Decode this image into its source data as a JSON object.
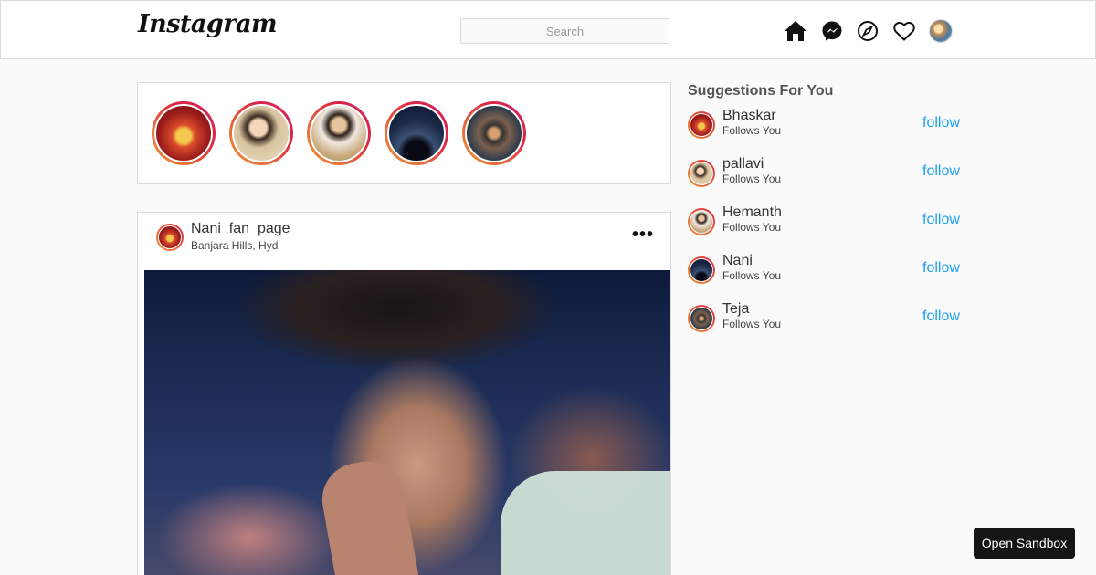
{
  "header": {
    "logo": "Instagram",
    "search_placeholder": "Search",
    "icons": [
      "home-icon",
      "messenger-icon",
      "explore-icon",
      "heart-icon",
      "profile-avatar"
    ]
  },
  "stories": [
    {
      "image": "ganesha"
    },
    {
      "image": "man-in-car"
    },
    {
      "image": "man-outdoors"
    },
    {
      "image": "mountain-night-sky"
    },
    {
      "image": "group-selfie"
    }
  ],
  "post": {
    "username": "Nani_fan_page",
    "location": "Banjara Hills, Hyd",
    "more_label": "•••"
  },
  "suggestions": {
    "title": "Suggestions For You",
    "items": [
      {
        "name": "Bhaskar",
        "subtitle": "Follows You",
        "action": "follow"
      },
      {
        "name": "pallavi",
        "subtitle": "Follows You",
        "action": "follow"
      },
      {
        "name": "Hemanth",
        "subtitle": "Follows You",
        "action": "follow"
      },
      {
        "name": "Nani",
        "subtitle": "Follows You",
        "action": "follow"
      },
      {
        "name": "Teja",
        "subtitle": "Follows You",
        "action": "follow"
      }
    ]
  },
  "sandbox_button": "Open Sandbox",
  "colors": {
    "follow_link": "#1ba0f2",
    "story_ring": "#dc2743",
    "border": "#dbdbdb"
  }
}
